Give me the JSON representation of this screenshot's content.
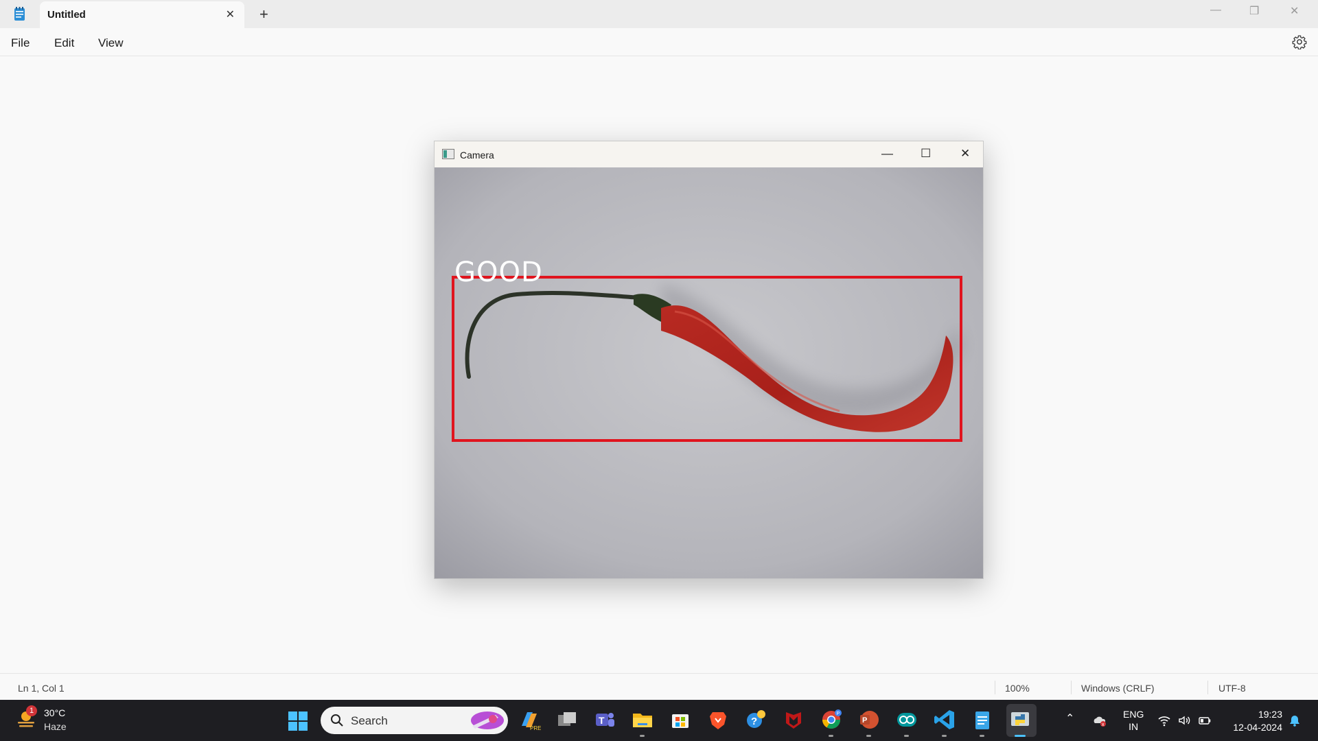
{
  "notepad": {
    "tab_title": "Untitled",
    "menu": [
      "File",
      "Edit",
      "View"
    ]
  },
  "camera_window": {
    "title": "Camera",
    "detection_label": "GOOD",
    "box_color": "#e0141e"
  },
  "status_bar": {
    "position": "Ln 1, Col 1",
    "zoom": "100%",
    "line_ending": "Windows (CRLF)",
    "encoding": "UTF-8"
  },
  "taskbar": {
    "weather": {
      "temp": "30°C",
      "condition": "Haze",
      "badge": "1"
    },
    "search_placeholder": "Search",
    "language": [
      "ENG",
      "IN"
    ],
    "time": "19:23",
    "date": "12-04-2024",
    "apps": [
      "copilot-icon",
      "task-view-icon",
      "teams-icon",
      "file-explorer-icon",
      "store-icon",
      "brave-icon",
      "quick-assist-icon",
      "mcafee-icon",
      "chrome-icon",
      "powerpoint-icon",
      "arduino-icon",
      "vscode-icon",
      "notepad-icon",
      "python-icon"
    ]
  },
  "colors": {
    "accent": "#4cc2ff",
    "taskbar_bg": "#1e1e22",
    "detection_box": "#e0141e"
  }
}
